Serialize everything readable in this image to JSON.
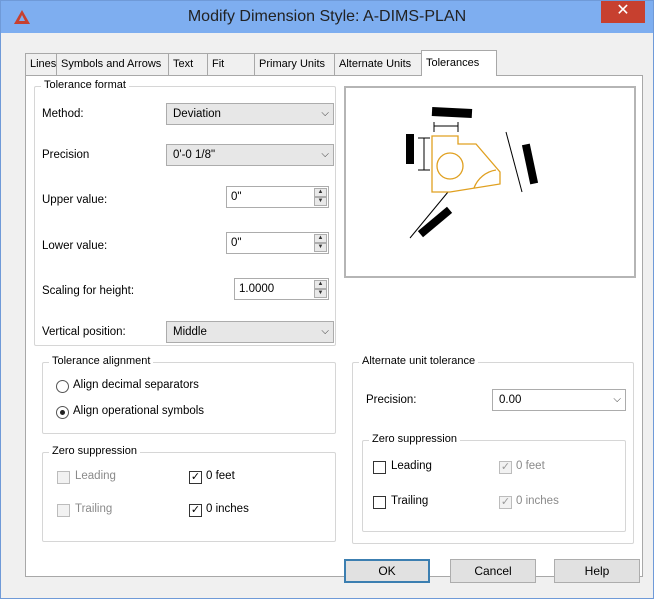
{
  "window": {
    "title": "Modify Dimension Style: A-DIMS-PLAN",
    "close_glyph": "✕",
    "brand_color": "#c7402f"
  },
  "tabs": [
    {
      "label": "Lines",
      "active": false
    },
    {
      "label": "Symbols and Arrows",
      "active": false
    },
    {
      "label": "Text",
      "active": false
    },
    {
      "label": "Fit",
      "active": false
    },
    {
      "label": "Primary Units",
      "active": false
    },
    {
      "label": "Alternate Units",
      "active": false
    },
    {
      "label": "Tolerances",
      "active": true
    }
  ],
  "tolerance_format": {
    "group_label": "Tolerance format",
    "method_label": "Method:",
    "method_value": "Deviation",
    "precision_label": "Precision",
    "precision_value": "0'-0 1/8\"",
    "upper_label": "Upper value:",
    "upper_value": "0\"",
    "lower_label": "Lower value:",
    "lower_value": "0\"",
    "scaling_label": "Scaling for height:",
    "scaling_value": "1.0000",
    "vertical_label": "Vertical position:",
    "vertical_value": "Middle"
  },
  "tolerance_alignment": {
    "group_label": "Tolerance alignment",
    "options": [
      {
        "label": "Align decimal separators",
        "selected": false
      },
      {
        "label": "Align operational symbols",
        "selected": true
      }
    ]
  },
  "zero_suppression_primary": {
    "group_label": "Zero suppression",
    "leading": {
      "label": "Leading",
      "checked": false,
      "enabled": false
    },
    "trailing": {
      "label": "Trailing",
      "checked": false,
      "enabled": false
    },
    "feet": {
      "label": "0 feet",
      "checked": true,
      "enabled": true
    },
    "inches": {
      "label": "0 inches",
      "checked": true,
      "enabled": true
    }
  },
  "alternate_unit_tolerance": {
    "group_label": "Alternate unit tolerance",
    "precision_label": "Precision:",
    "precision_value": "0.00"
  },
  "zero_suppression_alternate": {
    "group_label": "Zero suppression",
    "leading": {
      "label": "Leading",
      "checked": false,
      "enabled": true
    },
    "trailing": {
      "label": "Trailing",
      "checked": false,
      "enabled": true
    },
    "feet": {
      "label": "0 feet",
      "checked": true,
      "enabled": false
    },
    "inches": {
      "label": "0 inches",
      "checked": true,
      "enabled": false
    }
  },
  "preview": {
    "shape_color": "#e0a020",
    "line_color": "#000000"
  },
  "buttons": {
    "ok": "OK",
    "cancel": "Cancel",
    "help": "Help"
  },
  "glyphs": {
    "dropdown": "⌵",
    "spin_up": "▲",
    "spin_down": "▼",
    "check": "✓"
  }
}
